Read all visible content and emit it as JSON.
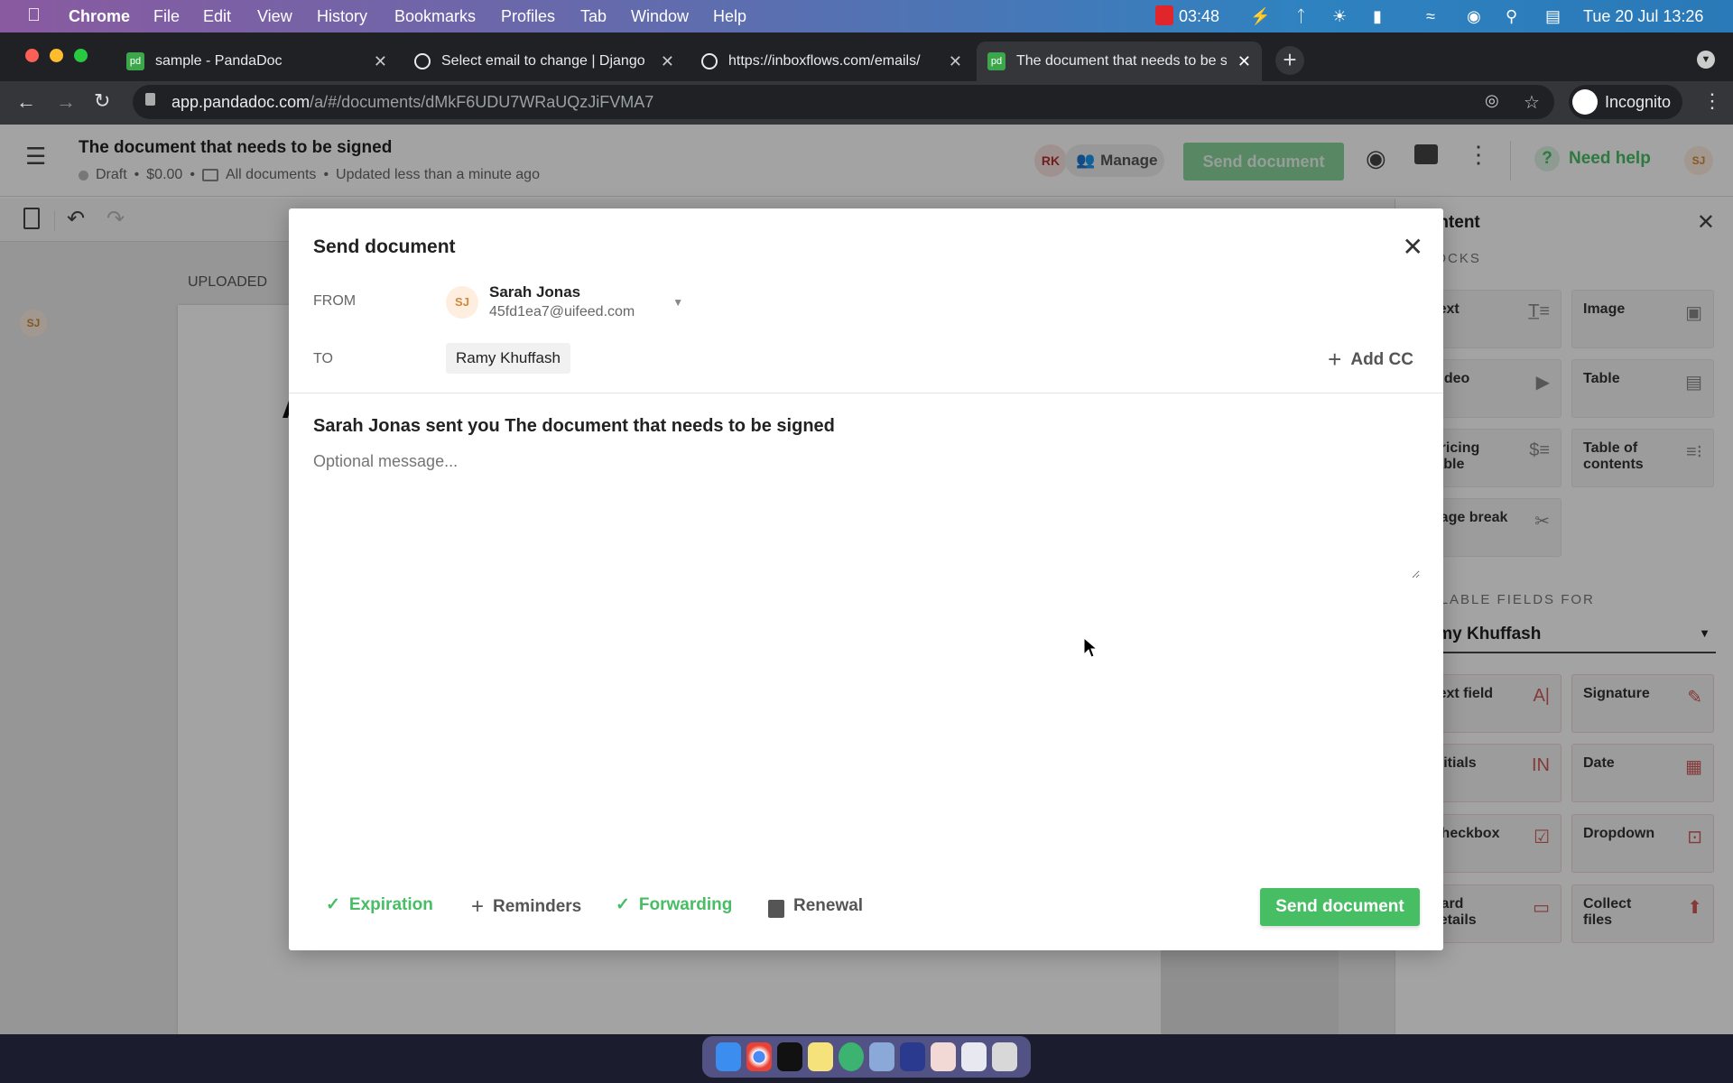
{
  "menubar": {
    "apple": "",
    "app": "Chrome",
    "items": [
      "File",
      "Edit",
      "View",
      "History",
      "Bookmarks",
      "Profiles",
      "Tab",
      "Window",
      "Help"
    ],
    "recorder_time": "03:48",
    "clock": "Tue 20 Jul  13:26"
  },
  "browser": {
    "tabs": [
      {
        "title": "sample - PandaDoc",
        "icon": "pandadoc-icon"
      },
      {
        "title": "Select email to change | Django",
        "icon": "globe-icon"
      },
      {
        "title": "https://inboxflows.com/emails/",
        "icon": "globe-icon"
      },
      {
        "title": "The document that needs to be signed",
        "icon": "pandadoc-icon",
        "active": true
      }
    ],
    "url_host": "app.pandadoc.com",
    "url_path": "/a/#/documents/dMkF6UDU7WRaUQzJiFVMA7",
    "profile": "Incognito"
  },
  "app": {
    "doc_title": "The document that needs to be signed",
    "status": "Draft",
    "amount": "$0.00",
    "folder": "All documents",
    "updated": "Updated less than a minute ago",
    "rk": "RK",
    "manage": "Manage",
    "send_document": "Send document",
    "need_help": "Need help",
    "user_initials": "SJ",
    "uploaded": "UPLOADED",
    "doc_letter": "A"
  },
  "panel": {
    "title": "Content",
    "blocks_label": "BLOCKS",
    "blocks": [
      "Text",
      "Image",
      "Video",
      "Table",
      "Pricing table",
      "Table of contents",
      "Page break"
    ],
    "fields_label": "FILLABLE FIELDS FOR",
    "recipient": "Ramy Khuffash",
    "fields": [
      "Text field",
      "Signature",
      "Initials",
      "Date",
      "Checkbox",
      "Dropdown",
      "Card details",
      "Collect files"
    ]
  },
  "modal": {
    "title": "Send document",
    "from_label": "FROM",
    "from_initials": "SJ",
    "from_name": "Sarah Jonas",
    "from_email": "45fd1ea7@uifeed.com",
    "to_label": "TO",
    "to_recipient": "Ramy Khuffash",
    "add_cc": "Add CC",
    "subject": "Sarah Jonas sent you The document that needs to be signed",
    "message_placeholder": "Optional message...",
    "options": [
      {
        "label": "Expiration",
        "state": "enabled"
      },
      {
        "label": "Reminders",
        "state": "add"
      },
      {
        "label": "Forwarding",
        "state": "enabled"
      },
      {
        "label": "Renewal",
        "state": "locked"
      }
    ],
    "send_button": "Send document"
  },
  "colors": {
    "accent_green": "#47be64",
    "field_red": "#d05a5a"
  }
}
